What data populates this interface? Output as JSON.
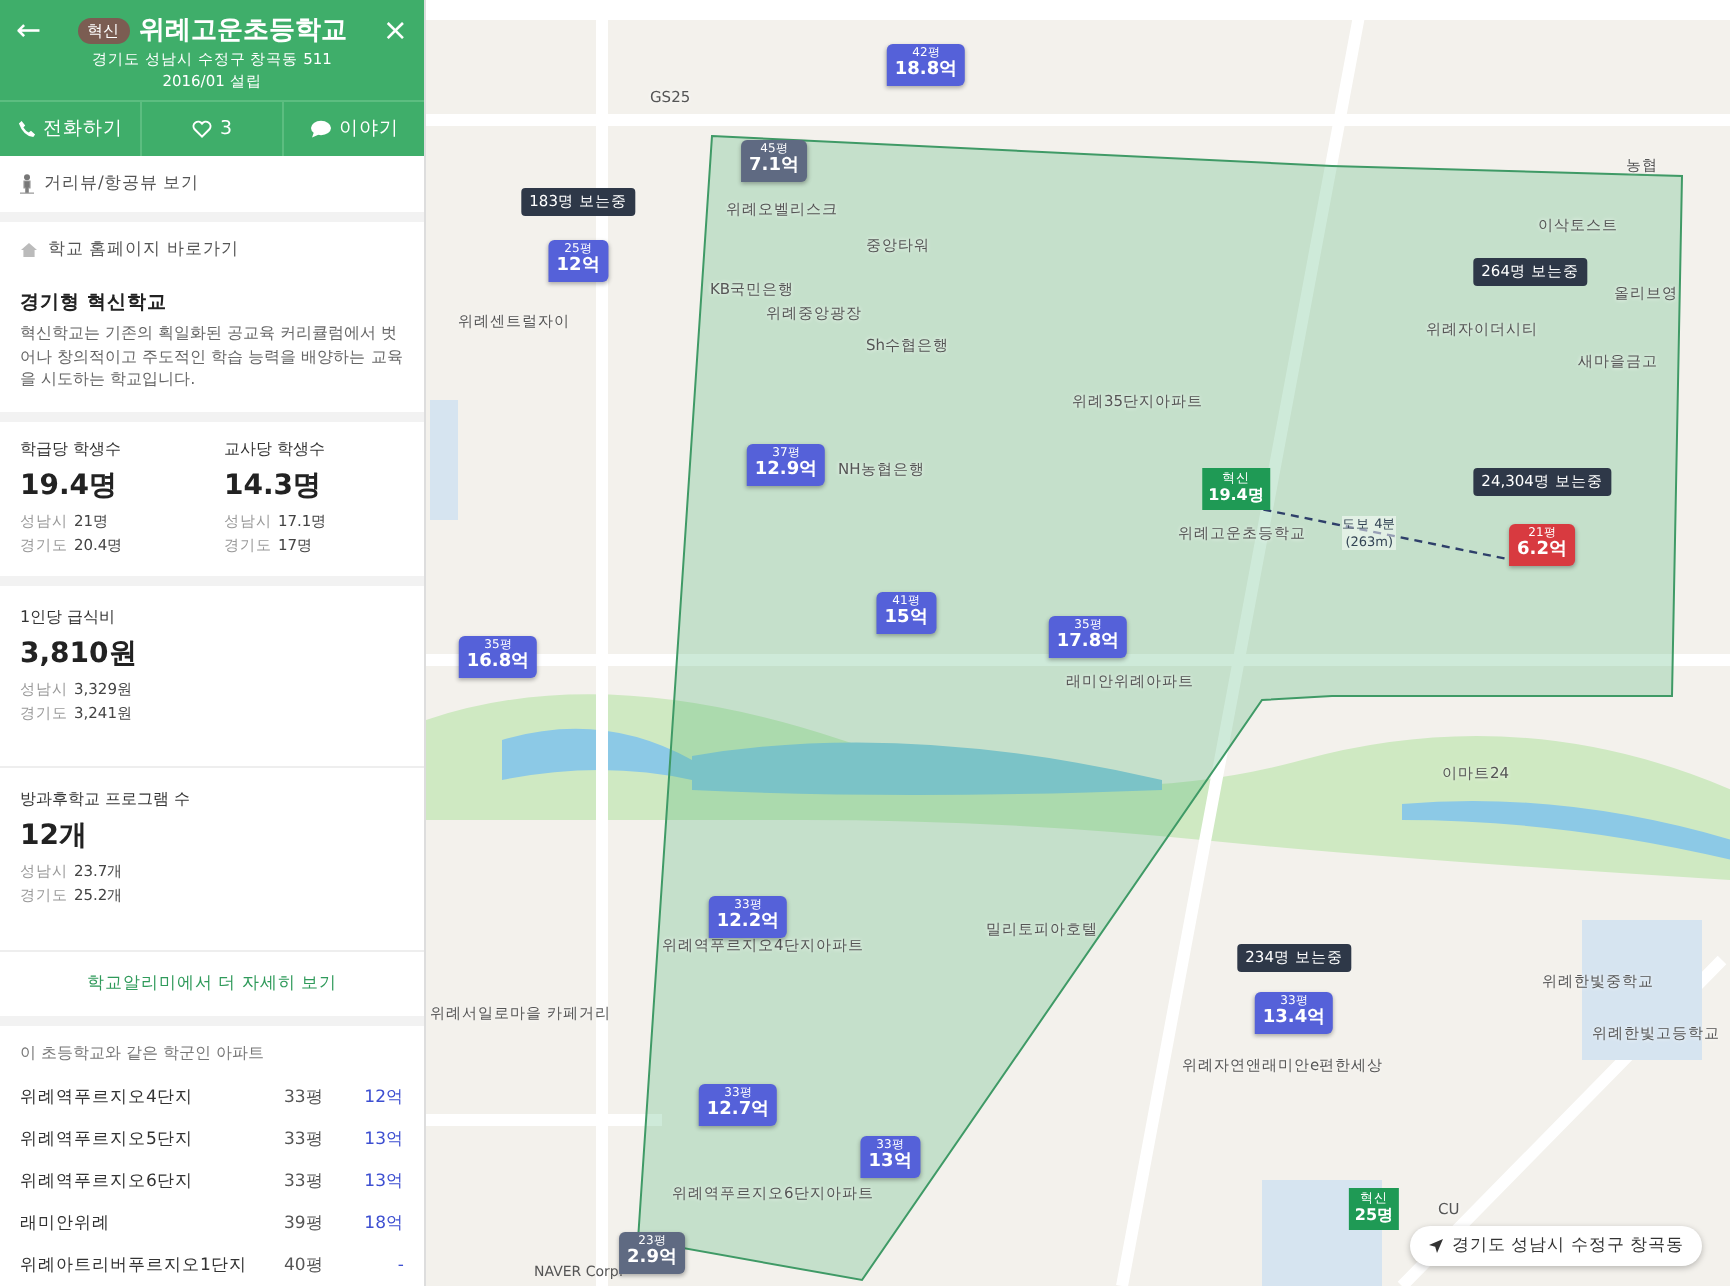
{
  "header": {
    "back": "←",
    "badge": "혁신",
    "title": "위례고운초등학교",
    "close": "×",
    "address": "경기도 성남시 수정구 창곡동 511",
    "founded": "2016/01 설립"
  },
  "actions": [
    {
      "kind": "phone",
      "label": "전화하기"
    },
    {
      "kind": "like",
      "label": "3"
    },
    {
      "kind": "chat",
      "label": "이야기"
    }
  ],
  "street_view": "거리뷰/항공뷰 보기",
  "homepage": "학교 홈페이지 바로가기",
  "feature": {
    "title": "경기형 혁신학교",
    "text": "혁신학교는 기존의 획일화된 공교육 커리큘럼에서 벗어나 창의적이고 주도적인 학습 능력을 배양하는 교육을 시도하는 학교입니다."
  },
  "stats": [
    {
      "label": "학급당 학생수",
      "value": "19.4명",
      "city": "성남시",
      "city_value": "21명",
      "province": "경기도",
      "province_value": "20.4명"
    },
    {
      "label": "교사당 학생수",
      "value": "14.3명",
      "city": "성남시",
      "city_value": "17.1명",
      "province": "경기도",
      "province_value": "17명"
    },
    {
      "label": "1인당 급식비",
      "value": "3,810원",
      "city": "성남시",
      "city_value": "3,329원",
      "province": "경기도",
      "province_value": "3,241원"
    },
    {
      "label": "방과후학교 프로그램 수",
      "value": "12개",
      "city": "성남시",
      "city_value": "23.7개",
      "province": "경기도",
      "province_value": "25.2개"
    }
  ],
  "more_link": "학교알리미에서 더 자세히 보기",
  "apartments": {
    "title": "이 초등학교와 같은 학군인 아파트",
    "rows": [
      {
        "name": "위례역푸르지오4단지",
        "size": "33평",
        "price": "12억"
      },
      {
        "name": "위례역푸르지오5단지",
        "size": "33평",
        "price": "13억"
      },
      {
        "name": "위례역푸르지오6단지",
        "size": "33평",
        "price": "13억"
      },
      {
        "name": "래미안위례",
        "size": "39평",
        "price": "18억"
      },
      {
        "name": "위례아트리버푸르지오1단지",
        "size": "40평",
        "price": "-"
      }
    ]
  },
  "map": {
    "place_labels": [
      "농협",
      "위례오벨리스크",
      "중앙타워",
      "KB국민은행",
      "위례중앙광장",
      "Sh수협은행",
      "위례35단지아파트",
      "NH농협은행",
      "위례고운초등학교",
      "위례자이더시티",
      "이삭토스트",
      "올리브영",
      "새마을금고",
      "위례센트럴자이",
      "래미안위례아파트",
      "위례서일로마을 카페거리",
      "이마트24",
      "위례한빛중학교",
      "위례한빛고등학교",
      "위례자연앤래미안e편한세상",
      "밀리토피아호텔",
      "위례역푸르지오4단지아파트",
      "위례역푸르지오6단지아파트",
      "CU",
      "GS25"
    ],
    "price_markers": [
      {
        "size": "42평",
        "price": "18.8억",
        "color": "#5561d9"
      },
      {
        "size": "45평",
        "price": "7.1억",
        "color": "#5f6a82"
      },
      {
        "size": "25평",
        "price": "12억",
        "color": "#5561d9"
      },
      {
        "size": "37평",
        "price": "12.9억",
        "color": "#5561d9"
      },
      {
        "size": "41평",
        "price": "15억",
        "color": "#5561d9"
      },
      {
        "size": "35평",
        "price": "17.8억",
        "color": "#5561d9"
      },
      {
        "size": "35평",
        "price": "16.8억",
        "color": "#5561d9"
      },
      {
        "size": "21평",
        "price": "6.2억",
        "color": "#d83a40"
      },
      {
        "size": "33평",
        "price": "12.2억",
        "color": "#5561d9"
      },
      {
        "size": "33평",
        "price": "12.7억",
        "color": "#5561d9"
      },
      {
        "size": "33평",
        "price": "13억",
        "color": "#5561d9"
      },
      {
        "size": "33평",
        "price": "13.4억",
        "color": "#5561d9"
      },
      {
        "size": "23평",
        "price": "2.9억",
        "color": "#5f6a82"
      }
    ],
    "viewer_badges": [
      "183명 보는중",
      "264명 보는중",
      "24,304명 보는중",
      "234명 보는중"
    ],
    "school_flags": [
      {
        "badge": "혁신",
        "value": "19.4명"
      },
      {
        "badge": "혁신",
        "value": "25명"
      }
    ],
    "distance": {
      "time": "도보 4분",
      "length": "(263m)"
    },
    "location": "경기도 성남시 수정구 창곡동",
    "attribution": "NAVER Corp."
  }
}
